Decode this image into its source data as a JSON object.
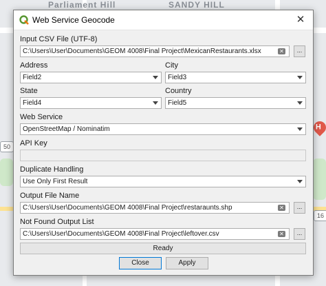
{
  "map": {
    "labels": [
      "Parliament Hill",
      "SANDY HILL"
    ],
    "shields": [
      "50",
      "16"
    ],
    "pin_glyph": "H"
  },
  "dialog": {
    "title": "Web Service Geocode",
    "close_glyph": "✕",
    "input_csv": {
      "label": "Input CSV File (UTF-8)",
      "value": "C:\\Users\\User\\Documents\\GEOM 4008\\Final Project\\MexicanRestaurants.xlsx"
    },
    "address": {
      "label": "Address",
      "value": "Field2"
    },
    "city": {
      "label": "City",
      "value": "Field3"
    },
    "state": {
      "label": "State",
      "value": "Field4"
    },
    "country": {
      "label": "Country",
      "value": "Field5"
    },
    "web_service": {
      "label": "Web Service",
      "value": "OpenStreetMap / Nominatim"
    },
    "api_key": {
      "label": "API Key",
      "value": ""
    },
    "duplicate_handling": {
      "label": "Duplicate Handling",
      "value": "Use Only First Result"
    },
    "output_file": {
      "label": "Output File Name",
      "value": "C:\\Users\\User\\Documents\\GEOM 4008\\Final Project\\restaraunts.shp"
    },
    "not_found": {
      "label": "Not Found Output List",
      "value": "C:\\Users\\User\\Documents\\GEOM 4008\\Final Project\\leftover.csv"
    },
    "browse_label": "...",
    "clear_glyph": "✕",
    "status": "Ready",
    "buttons": {
      "close": "Close",
      "apply": "Apply"
    }
  },
  "colors": {
    "accent": "#0078d7",
    "qgis_green": "#589632",
    "qgis_yellow": "#ee7913"
  }
}
